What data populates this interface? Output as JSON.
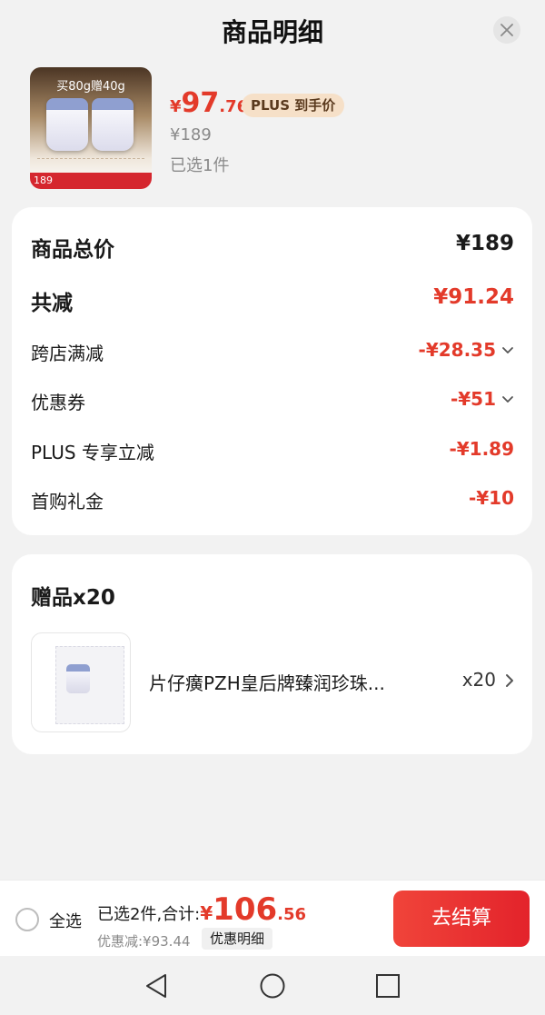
{
  "header": {
    "title": "商品明细"
  },
  "product": {
    "thumb_promo": "买80g赠40g",
    "thumb_price": "189",
    "price_symbol": "¥",
    "price_int": "97",
    "price_dec": ".76",
    "plus_badge": "PLUS 到手价",
    "original_price": "¥189",
    "selected_count": "已选1件"
  },
  "price_breakdown": {
    "rows": [
      {
        "label": "商品总价",
        "value": "¥189"
      },
      {
        "label": "共减",
        "value": "¥91.24"
      },
      {
        "label": "跨店满减",
        "value": "-¥28.35"
      },
      {
        "label": "优惠券",
        "value": "-¥51"
      },
      {
        "label": "PLUS 专享立减",
        "value": "-¥1.89"
      },
      {
        "label": "首购礼金",
        "value": "-¥10"
      }
    ]
  },
  "gifts": {
    "title": "赠品x20",
    "item": {
      "name": "片仔癀PZH皇后牌臻润珍珠...",
      "qty": "x20"
    }
  },
  "checkout": {
    "select_all": "全选",
    "summary_label": "已选2件,合计:",
    "total_symbol": "¥",
    "total_int": "106",
    "total_dec": ".56",
    "discount": "优惠减:¥93.44",
    "detail_button": "优惠明细",
    "pay_button": "去结算"
  },
  "colors": {
    "accent_red": "#e33a2a",
    "plus_badge_bg": "#f6e0c8",
    "background": "#f2f2f2"
  },
  "icons": [
    "close-icon",
    "chevron-down-icon",
    "chevron-right-icon",
    "radio-icon",
    "nav-back-icon",
    "nav-home-icon",
    "nav-recent-icon"
  ]
}
